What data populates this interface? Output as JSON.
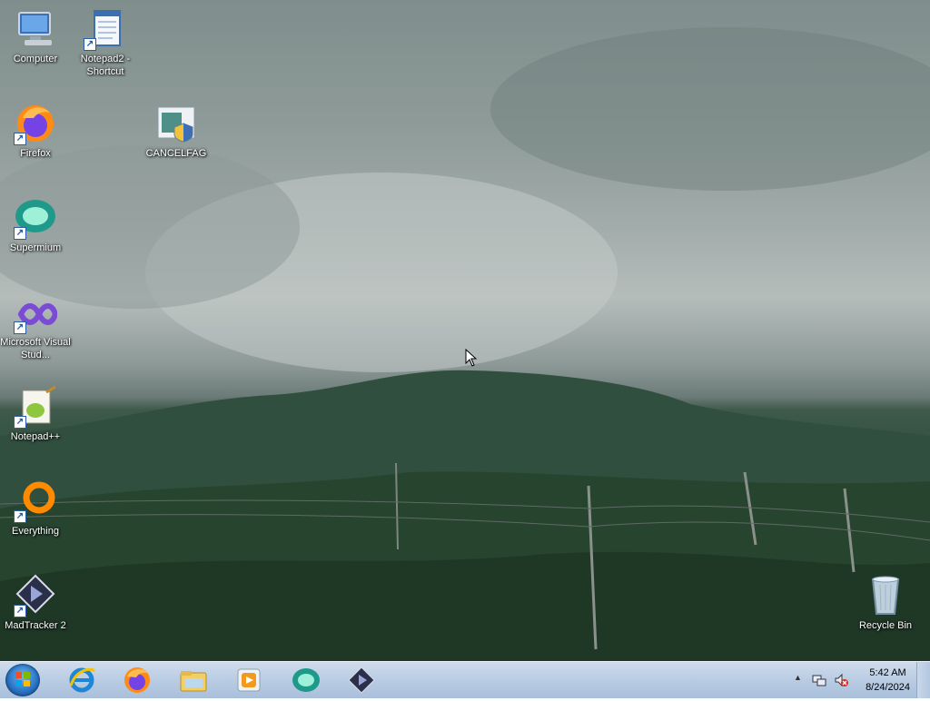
{
  "desktop": {
    "icons": [
      {
        "label": "Computer"
      },
      {
        "label": "Notepad2 - Shortcut"
      },
      {
        "label": "Firefox"
      },
      {
        "label": "CANCELFAG"
      },
      {
        "label": "Supermium"
      },
      {
        "label": "Microsoft Visual Stud..."
      },
      {
        "label": "Notepad++"
      },
      {
        "label": "Everything"
      },
      {
        "label": "MadTracker 2"
      },
      {
        "label": "Recycle Bin"
      }
    ]
  },
  "taskbar": {
    "pinned": [
      "ie-icon",
      "firefox-icon",
      "explorer-icon",
      "media-player-icon",
      "supermium-icon",
      "madtracker-icon"
    ],
    "clock": {
      "time": "5:42 AM",
      "date": "8/24/2024"
    }
  }
}
